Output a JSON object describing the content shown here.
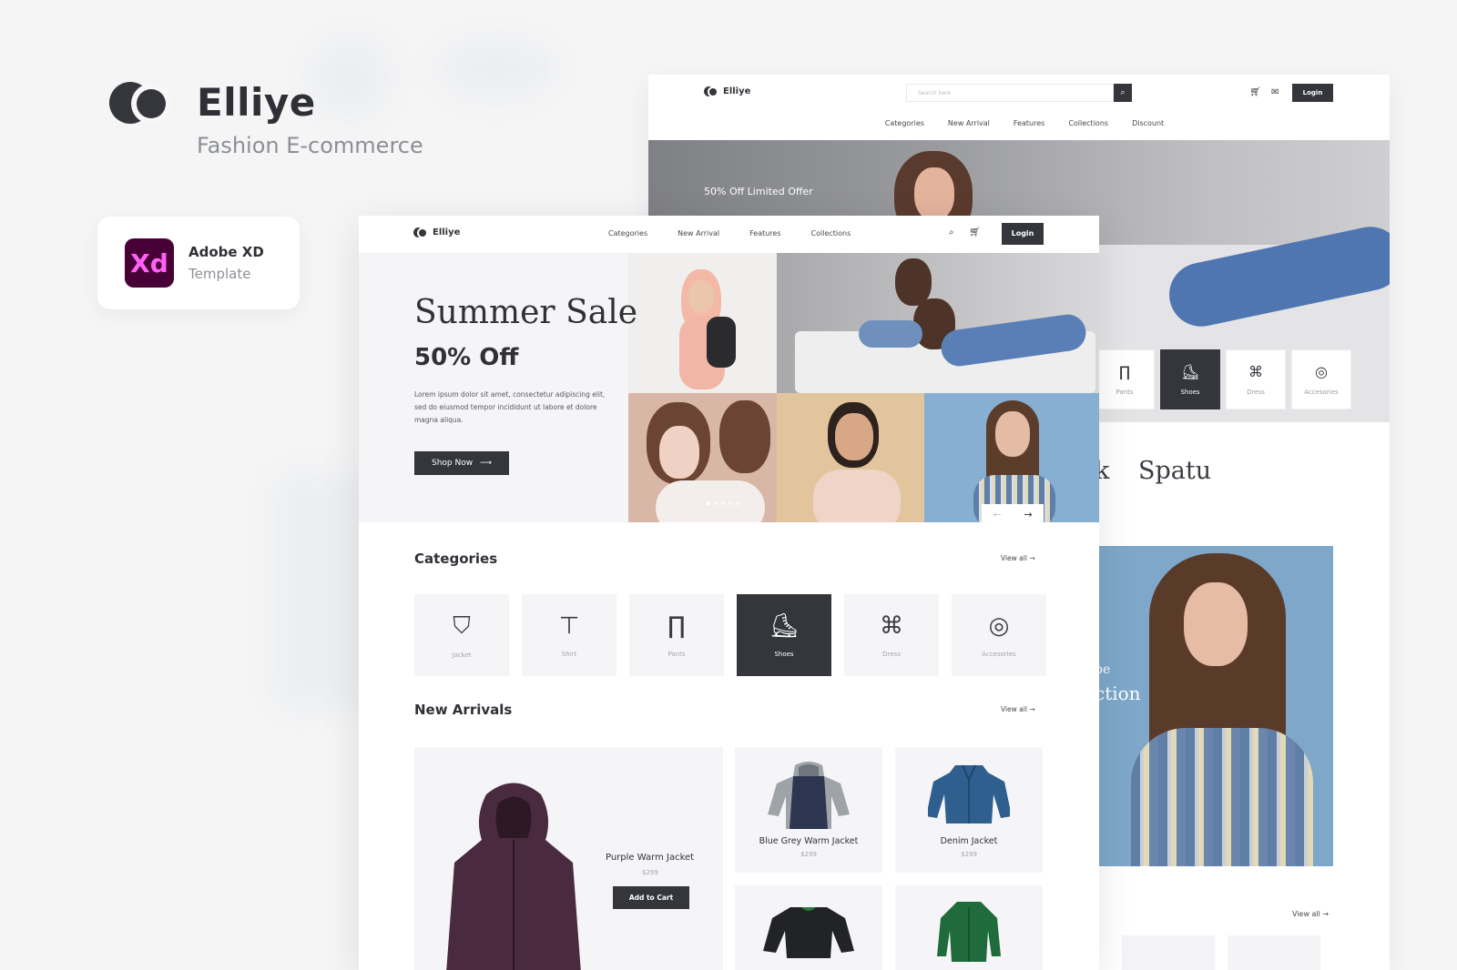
{
  "brand": {
    "name": "Elliye",
    "subtitle": "Fashion E-commerce"
  },
  "badge": {
    "app": "Adobe XD",
    "kind": "Template",
    "logo_text": "Xd"
  },
  "back_mockup": {
    "logo": "Elliye",
    "search_placeholder": "Search here",
    "login": "Login",
    "nav": [
      "Categories",
      "New Arrival",
      "Features",
      "Collections",
      "Discount"
    ],
    "hero_offer": "50% Off Limited Offer",
    "categories": [
      {
        "label": "Pants",
        "icon": "pants-icon"
      },
      {
        "label": "Shoes",
        "icon": "shoes-icon",
        "active": true
      },
      {
        "label": "Dress",
        "icon": "dress-icon"
      },
      {
        "label": "Accesories",
        "icon": "belt-icon"
      }
    ],
    "heading_fragment": "k",
    "heading": "Spatu",
    "promo_fragment_1": "pe",
    "promo_fragment_2": "ction",
    "view_all": "View all"
  },
  "front_mockup": {
    "logo": "Elliye",
    "nav": [
      "Categories",
      "New Arrival",
      "Features",
      "Collections"
    ],
    "login": "Login",
    "hero": {
      "title": "Summer Sale",
      "subtitle": "50% Off",
      "body": "Lorem ipsum dolor sit amet, consectetur adipiscing elit, sed do eiusmod tempor incididunt ut labore et dolore magna aliqua.",
      "cta": "Shop Now"
    },
    "categories_section": {
      "title": "Categories",
      "view_all": "View all",
      "items": [
        {
          "label": "Jacket",
          "icon": "jacket-icon"
        },
        {
          "label": "Shirt",
          "icon": "shirt-icon"
        },
        {
          "label": "Pants",
          "icon": "pants-icon"
        },
        {
          "label": "Shoes",
          "icon": "shoes-icon",
          "active": true
        },
        {
          "label": "Dress",
          "icon": "dress-icon"
        },
        {
          "label": "Accesories",
          "icon": "belt-icon"
        }
      ]
    },
    "new_arrivals": {
      "title": "New Arrivals",
      "view_all": "View all",
      "featured": {
        "name": "Purple Warm Jacket",
        "price": "$299",
        "cta": "Add to Cart"
      },
      "products": [
        {
          "name": "Blue Grey Warm Jacket",
          "price": "$299"
        },
        {
          "name": "Denim Jacket",
          "price": "$299"
        }
      ]
    }
  },
  "colors": {
    "dark": "#34363c",
    "xd_bg": "#470137",
    "xd_fg": "#ff61f6",
    "panel": "#f5f5f7"
  }
}
